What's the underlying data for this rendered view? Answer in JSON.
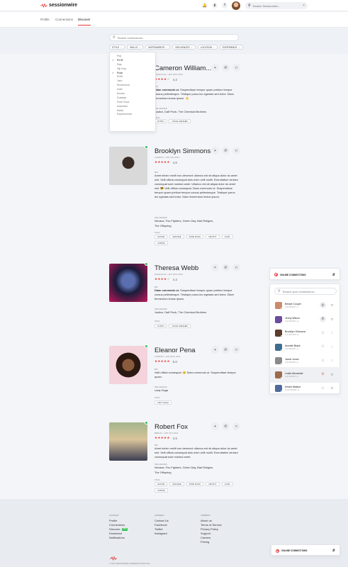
{
  "brand": {
    "name": "sessionwire",
    "accent": "#e53935"
  },
  "header": {
    "search_placeholder": "Search Sessionwire...",
    "icons": [
      "bell-icon",
      "download-icon",
      "help-icon"
    ]
  },
  "subnav": {
    "tabs": [
      "Profile",
      "Connections",
      "Discover"
    ],
    "active": "Discover"
  },
  "discover": {
    "search_placeholder": "Search connections...",
    "filters": [
      "STYLE",
      "SKILLS",
      "INSTRUMENTS",
      "INFLUENCES",
      "LOCATION",
      "EXPERIENCE"
    ],
    "style_options": [
      "Pop",
      "R'n'B",
      "Rap",
      "Hip Hop",
      "Rock",
      "EDM",
      "Jazz",
      "Electronica",
      "Indie",
      "Electro",
      "Dubstep",
      "Punk Rock",
      "Industrial",
      "Metal",
      "Experimental"
    ],
    "style_selected": [
      "R'n'B",
      "Rock"
    ]
  },
  "cards": [
    {
      "name": "Cameron William...",
      "meta": "Nashville • Jan 19th 2021",
      "rating": "4.2",
      "stars": 4,
      "bio_label": "BIO",
      "bio_bold": "Diam commodo ut.",
      "bio": "Suspendisse tempor quam pretium tempor cursus pellentesque. Tristique purus leo egestas sed tortor. Diam fermentum lectus ipsum. 👋",
      "influences_label": "INFLUENCES",
      "influences": "Justice, Daft Punk, The Chemical Brothers",
      "tags_label": "TAGS",
      "tags": [
        "Synth",
        "Vocal Ranger"
      ]
    },
    {
      "name": "Brooklyn Simmons",
      "meta": "London • Jun 4th 2021",
      "rating": "4.8",
      "stars": 5,
      "bio_label": "BIO",
      "bio": "Amet minim mollit non deserunt ullamco est sit aliqua dolor do amet sint. Velit officia consequat duis enim velit mollit. Exercitation veniam consequat sunt nostrud amet. Ullamco est sit aliqua dolor do amet sint. 😎 Velit officia consequat. Diam commodo ut. Suspendisse tempor quam pretium tempor cursus pellentesque. Tristique purus leo egestas sed tortor. Diam fermentum lectus ipsum.",
      "influences_label": "INFLUENCES",
      "influences": "Nirvana, Foo Fighters, Green Day, Bad Religion,",
      "influences2": "The Offspring",
      "tags_label": "TAGS",
      "tags": [
        "Guitar",
        "Grunge",
        "Punk Rock",
        "Crusty",
        "Loud",
        "Cuping"
      ]
    },
    {
      "name": "Theresa Webb",
      "meta": "Nashville • Jan 19th 2021",
      "rating": "4.2",
      "stars": 4,
      "bio_label": "BIO",
      "bio_bold": "Diam commodo ut.",
      "bio": "Suspendisse tempor quam pretium tempor cursus pellentesque. Tristique purus leo egestas sed tortor. Diam fermentum lectus ipsum.",
      "influences_label": "INFLUENCES",
      "influences": "Justice, Daft Punk, The Chemical Brothers",
      "tags_label": "TAGS",
      "tags": [
        "Synth",
        "Vocal Ranger"
      ]
    },
    {
      "name": "Eleanor Pena",
      "meta": "London • Jan 19th 2021",
      "rating": "5.0",
      "stars": 5,
      "bio_label": "BIO",
      "bio": "Velit officia consequat. 😊 Diam commodo ut. Suspendisse tempor quam.",
      "influences_label": "INFLUENCES",
      "influences": "Lady Gaga",
      "tags_label": "TAGS",
      "tags": [
        "Lady Gaga"
      ]
    },
    {
      "name": "Robert Fox",
      "meta": "Berlin • Jun 4th 2021",
      "rating": "4.9",
      "stars": 5,
      "bio_label": "BIO",
      "bio": "Amet minim mollit non deserunt ullamco est sit aliqua dolor do amet sint. Velit officia consequat duis enim velit mollit. Exercitation veniam consequat sunt nostrud amet.",
      "influences_label": "INFLUENCES",
      "influences": "Nirvana, Foo Fighters, Green Day, Bad Religion,",
      "influences2": "The Offspring",
      "tags_label": "TAGS",
      "tags": [
        "Guitar",
        "Grunge",
        "Punk Rock",
        "Crusty",
        "Loud",
        "Cuping"
      ]
    }
  ],
  "connections_panel": {
    "title": "ONLINE CONNECTIONS",
    "search_placeholder": "Search your connections...",
    "contacts": [
      {
        "name": "Bessie Cooper",
        "time": "1:24 PM EST +1"
      },
      {
        "name": "Jenny Wilson",
        "time": "1:24 PM EST +3"
      },
      {
        "name": "Brooklyn Simmons",
        "time": "1:24 PM GMT +0"
      },
      {
        "name": "Annette Black",
        "time": "1:24 PM EST +1"
      },
      {
        "name": "Jacob Jones",
        "time": "2:24 PM EST +1"
      },
      {
        "name": "Leslie Alexander",
        "time": "1:24 PM EST +1"
      },
      {
        "name": "Kristin Watson",
        "time": "12:24 PM EST +1"
      }
    ]
  },
  "mini_panel": {
    "title": "ONLINE CONNECTIONS"
  },
  "footer": {
    "account": {
      "head": "ACCOUNT",
      "links": [
        "Profile",
        "Connections",
        "Discover",
        "Download",
        "Notifications"
      ],
      "new_badge": "NEW"
    },
    "connect": {
      "head": "CONNECT",
      "links": [
        "Contact Us",
        "Facebook",
        "Twitter",
        "Instagram"
      ]
    },
    "company": {
      "head": "COMPANY",
      "links": [
        "About us",
        "Terms of Service",
        "Privacy Policy",
        "Support",
        "Careers",
        "Pricing"
      ]
    },
    "copyright": "© 2021 SESSIONWIRE COMMUNICATIONS INC."
  }
}
